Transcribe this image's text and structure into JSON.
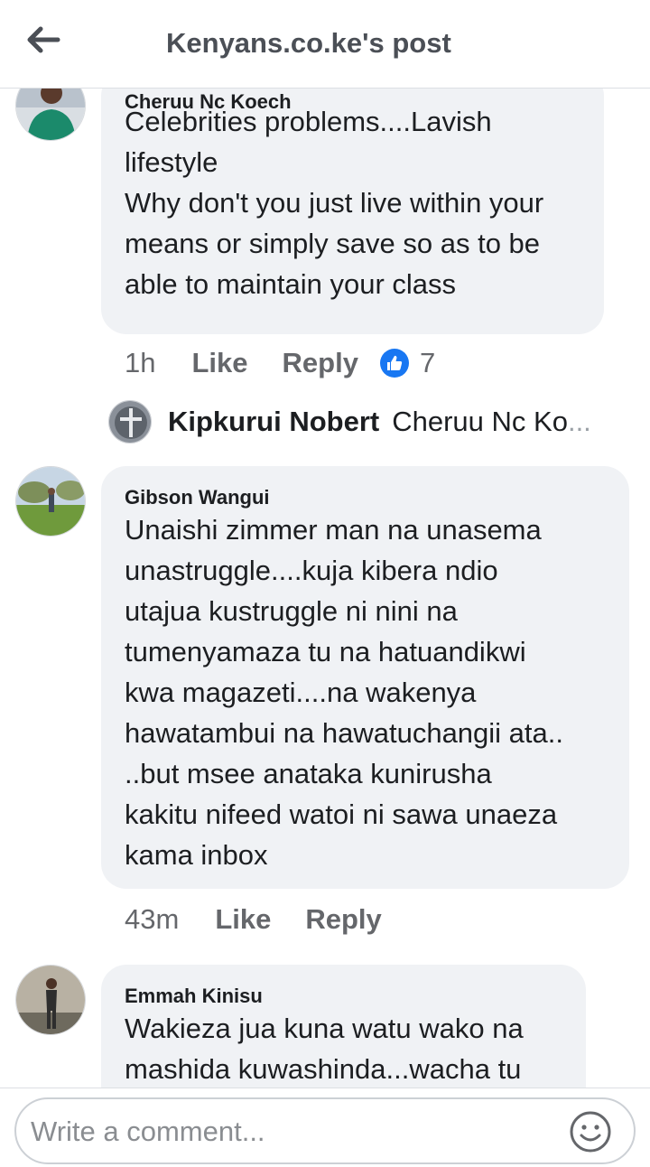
{
  "header": {
    "title": "Kenyans.co.ke's post",
    "back_icon": "arrow-left-icon"
  },
  "comments": [
    {
      "author": "Cheruu Nc Koech",
      "text": "Celebrities problems....Lavish\nlifestyle\nWhy don't you just live within your\nmeans or simply save so as to be\nable to maintain your class",
      "time": "1h",
      "like_label": "Like",
      "reply_label": "Reply",
      "reaction_icon": "thumbs-up-icon",
      "reaction_count": "7",
      "reply_preview": {
        "name": "Kipkurui Nobert",
        "text": "Cheruu Nc Ko",
        "ellipsis": "..."
      }
    },
    {
      "author": "Gibson Wangui",
      "text": "Unaishi zimmer man na unasema\nunastruggle....kuja kibera ndio\nutajua kustruggle ni nini na\ntumenyamaza tu na hatuandikwi\nkwa magazeti....na wakenya\nhawatambui na hawatuchangii ata..\n..but msee anataka kunirusha\nkakitu nifeed watoi ni sawa unaeza\nkama inbox",
      "time": "43m",
      "like_label": "Like",
      "reply_label": "Reply"
    },
    {
      "author": "Emmah Kinisu",
      "text": "Wakieza jua kuna watu wako na\nmashida kuwashinda...wacha tu"
    }
  ],
  "composer": {
    "placeholder": "Write a comment...",
    "emoji_icon": "smiley-icon"
  },
  "colors": {
    "bubble": "#f0f2f5",
    "like_blue": "#1877f2",
    "meta_gray": "#65676b"
  }
}
